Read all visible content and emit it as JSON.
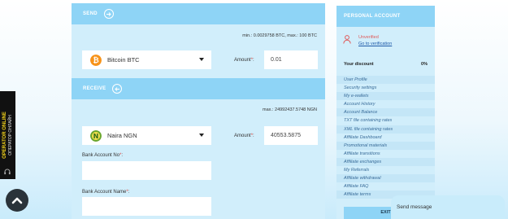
{
  "operator": {
    "line1": "OPERATOR ONLINE",
    "line2": "ОПЕРАТОР ОНЛАЙН"
  },
  "send": {
    "title": "SEND",
    "limits": "min.: 0.0029758 BTC, max.: 100 BTC",
    "currency": "Bitcoin BTC",
    "amount_label": "Amount",
    "amount_value": "0.01"
  },
  "receive": {
    "title": "RECEIVE",
    "limits": "max.: 24992437.5748 NGN",
    "currency": "Naira NGN",
    "amount_label": "Amount",
    "amount_value": "40553.5875",
    "bank_account_no_label": "Bank Account No",
    "bank_account_name_label": "Bank Account Name"
  },
  "account": {
    "title": "PERSONAL ACCOUNT",
    "status": "Unverified",
    "verify_link": "Go to verification",
    "discount_label": "Your discount",
    "discount_value": "0%",
    "menu": [
      "User Profile",
      "Security settings",
      "My e-wallets",
      "Account History",
      "Account Balance",
      "TXT file containing rates",
      "XML file containing rates",
      "Affiliate Dashboard",
      "Promotional materials",
      "Affiliate transitions",
      "Affiliate exchanges",
      "My Referrals",
      "Affiliate withdrawal",
      "Affiliate FAQ",
      "Affiliate terms"
    ],
    "exit_label": "EXIT"
  },
  "chat": {
    "label": "Send message"
  },
  "colors": {
    "header": "#8ed4f6",
    "panel": "#d1eefb",
    "link": "#3a6d9a",
    "warning": "#e05a5a",
    "bitcoin": "#f7931a",
    "naira": "#6aa62e"
  },
  "icons": {
    "send_arrow": "arrow-right-circle-icon",
    "receive_arrow": "arrow-left-circle-icon",
    "scroll_up": "chevron-up-icon",
    "user": "user-icon"
  }
}
